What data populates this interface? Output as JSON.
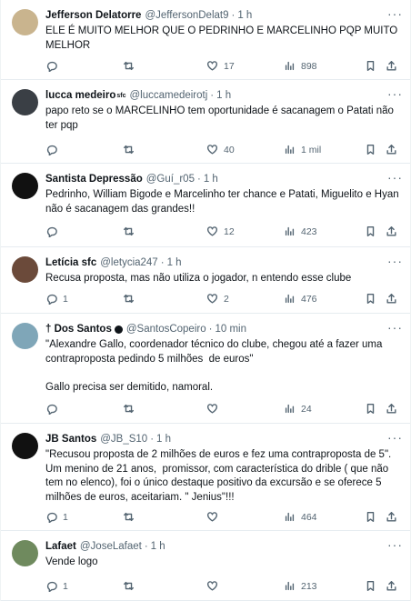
{
  "tweets": [
    {
      "name": "Jefferson Delatorre",
      "name_suffix": "",
      "handle": "@JeffersonDelat9",
      "time": "1 h",
      "text": "ELE É MUITO MELHOR QUE O PEDRINHO E MARCELINHO PQP MUITO MELHOR",
      "replies": "",
      "retweets": "",
      "likes": "17",
      "views": "898",
      "avatar_color": "#c9b48e"
    },
    {
      "name": "lucca medeiro",
      "name_suffix": "sfc",
      "handle": "@luccamedeirotj",
      "time": "1 h",
      "text": "papo reto se o MARCELINHO tem oportunidade é sacanagem o Patati não ter pqp",
      "replies": "",
      "retweets": "",
      "likes": "40",
      "views": "1 mil",
      "avatar_color": "#3a3f45"
    },
    {
      "name": "Santista Depressão",
      "name_suffix": "",
      "handle": "@Guí_r05",
      "time": "1 h",
      "text": "Pedrinho, William Bigode e Marcelinho ter chance e Patati, Miguelito e Hyan não é sacanagem das grandes!!",
      "replies": "",
      "retweets": "",
      "likes": "12",
      "views": "423",
      "avatar_color": "#111111"
    },
    {
      "name": "Letícia sfc",
      "name_suffix": "",
      "handle": "@letycia247",
      "time": "1 h",
      "text": "Recusa proposta, mas não utiliza o jogador, n entendo esse clube",
      "replies": "1",
      "retweets": "",
      "likes": "2",
      "views": "476",
      "avatar_color": "#6b4a3a"
    },
    {
      "name": "† Dos Santos",
      "name_suffix": "",
      "handle": "@SantosCopeiro",
      "time": "10 min",
      "text": "\"Alexandre Gallo, coordenador técnico do clube, chegou até a fazer uma contraproposta pedindo 5 milhões  de euros\"\n\nGallo precisa ser demitido, namoral.",
      "replies": "",
      "retweets": "",
      "likes": "",
      "views": "24",
      "avatar_color": "#7fa6b8"
    },
    {
      "name": "JB Santos",
      "name_suffix": "",
      "handle": "@JB_S10",
      "time": "1 h",
      "text": "\"Recusou proposta de 2 milhões de euros e fez uma contraproposta de 5\". Um menino de 21 anos,  promissor, com característica do drible ( que não tem no elenco), foi o único destaque positivo da excursão e se oferece 5 milhões de euros, aceitariam. \" Jenius\"!!!",
      "replies": "1",
      "retweets": "",
      "likes": "",
      "views": "464",
      "avatar_color": "#111111"
    },
    {
      "name": "Lafaet",
      "name_suffix": "",
      "handle": "@JoseLafaet",
      "time": "1 h",
      "text": "Vende logo",
      "replies": "1",
      "retweets": "",
      "likes": "",
      "views": "213",
      "avatar_color": "#6f8a5e"
    }
  ]
}
